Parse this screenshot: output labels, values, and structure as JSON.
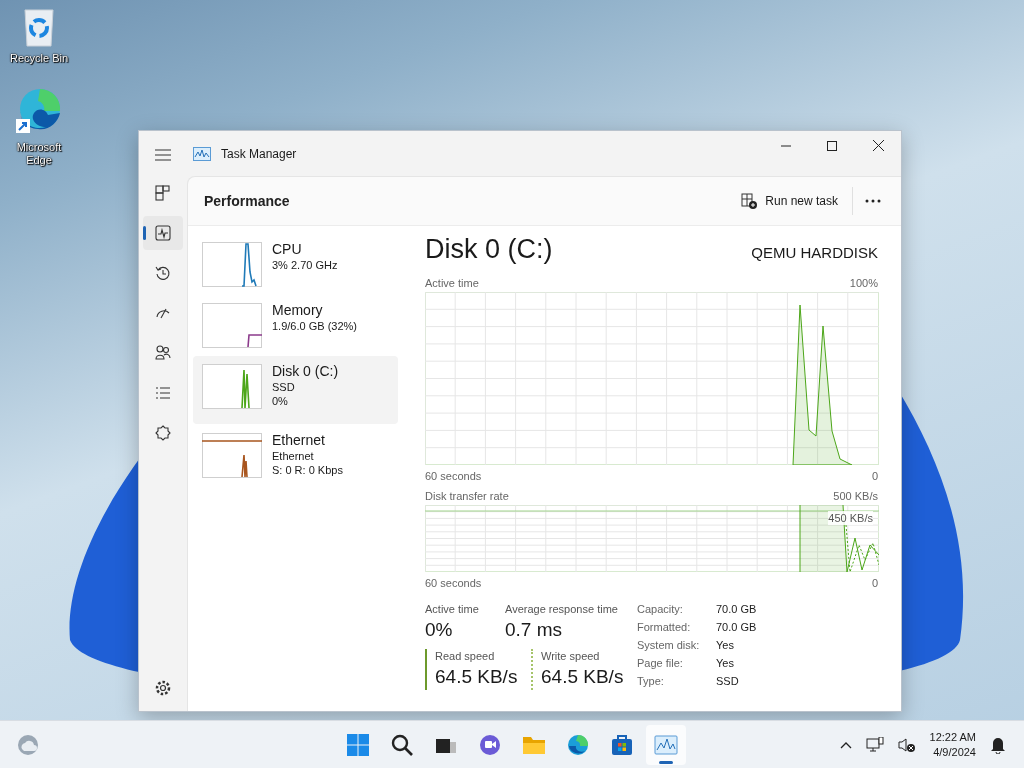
{
  "desktop_icons": [
    {
      "kind": "recycle-bin",
      "label": "Recycle Bin"
    },
    {
      "kind": "edge",
      "label": "Microsoft Edge"
    }
  ],
  "window": {
    "title": "Task Manager"
  },
  "nav": [
    {
      "kind": "processes",
      "selected": false
    },
    {
      "kind": "performance",
      "selected": true
    },
    {
      "kind": "app-history",
      "selected": false
    },
    {
      "kind": "startup",
      "selected": false
    },
    {
      "kind": "users",
      "selected": false
    },
    {
      "kind": "details",
      "selected": false
    },
    {
      "kind": "services",
      "selected": false
    }
  ],
  "page": {
    "title": "Performance",
    "run_task": "Run new task"
  },
  "resources": [
    {
      "kind": "cpu",
      "name": "CPU",
      "lines": [
        "3% 2.70 GHz"
      ],
      "color": "#1f7ab8",
      "selected": false
    },
    {
      "kind": "memory",
      "name": "Memory",
      "lines": [
        "1.9/6.0 GB (32%)"
      ],
      "color": "#8c3b8c",
      "selected": false
    },
    {
      "kind": "disk",
      "name": "Disk 0 (C:)",
      "lines": [
        "SSD",
        "0%"
      ],
      "color": "#4ca619",
      "selected": true
    },
    {
      "kind": "network",
      "name": "Ethernet",
      "lines": [
        "Ethernet",
        "S: 0 R: 0 Kbps"
      ],
      "color": "#a8551e",
      "selected": false
    }
  ],
  "detail": {
    "title": "Disk 0 (C:)",
    "model": "QEMU HARDDISK",
    "graphs": [
      {
        "kind": "active",
        "label": "Active time",
        "max": "100%",
        "span": "60 seconds",
        "min": "0"
      },
      {
        "kind": "transfer",
        "label": "Disk transfer rate",
        "max": "500 KB/s",
        "marker": "450 KB/s",
        "span": "60 seconds",
        "min": "0"
      }
    ],
    "stats": [
      {
        "label": "Active time",
        "value": "0%"
      },
      {
        "label": "Average response time",
        "value": "0.7 ms"
      }
    ],
    "speeds": [
      {
        "kind": "read",
        "label": "Read speed",
        "value": "64.5 KB/s"
      },
      {
        "kind": "write",
        "label": "Write speed",
        "value": "64.5 KB/s"
      }
    ],
    "properties": [
      {
        "label": "Capacity:",
        "value": "70.0 GB"
      },
      {
        "label": "Formatted:",
        "value": "70.0 GB"
      },
      {
        "label": "System disk:",
        "value": "Yes"
      },
      {
        "label": "Page file:",
        "value": "Yes"
      },
      {
        "label": "Type:",
        "value": "SSD"
      }
    ]
  },
  "taskbar": {
    "apps": [
      {
        "kind": "start",
        "selected": false
      },
      {
        "kind": "search",
        "selected": false
      },
      {
        "kind": "task-view",
        "selected": false
      },
      {
        "kind": "chat",
        "selected": false
      },
      {
        "kind": "explorer",
        "selected": false
      },
      {
        "kind": "edge",
        "selected": false
      },
      {
        "kind": "store",
        "selected": false
      },
      {
        "kind": "task-manager",
        "selected": true
      }
    ],
    "time": "12:22 AM",
    "date": "4/9/2024"
  }
}
